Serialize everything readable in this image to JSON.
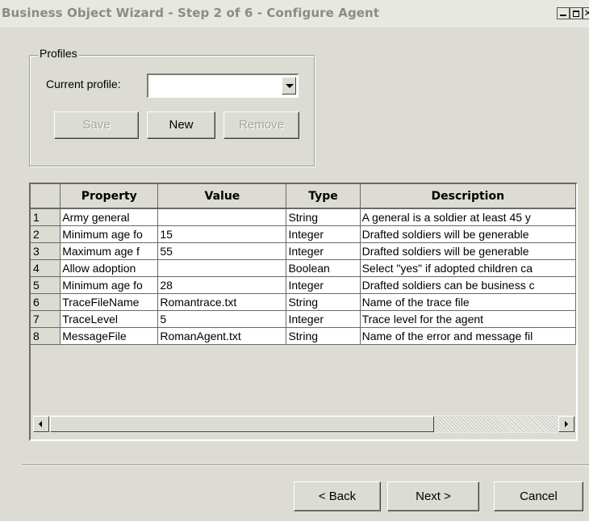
{
  "window": {
    "title": "Business Object Wizard - Step 2 of 6 - Configure Agent",
    "controls": [
      "minimize",
      "maximize",
      "close"
    ]
  },
  "profiles": {
    "legend": "Profiles",
    "current_profile_label": "Current profile:",
    "current_profile_value": "",
    "buttons": {
      "save": "Save",
      "new": "New",
      "remove": "Remove"
    }
  },
  "grid": {
    "columns": [
      "",
      "Property",
      "Value",
      "Type",
      "Description"
    ],
    "rows": [
      {
        "num": "1",
        "property": "Army general",
        "value": "",
        "type": "String",
        "description": "A general is a soldier at least 45 y"
      },
      {
        "num": "2",
        "property": "Minimum age fo",
        "value": "15",
        "type": "Integer",
        "description": "Drafted soldiers will be generable"
      },
      {
        "num": "3",
        "property": "Maximum age f",
        "value": "55",
        "type": "Integer",
        "description": "Drafted soldiers will be generable"
      },
      {
        "num": "4",
        "property": "Allow adoption",
        "value": "",
        "type": "Boolean",
        "description": "Select \"yes\" if adopted children ca"
      },
      {
        "num": "5",
        "property": "Minimum age fo",
        "value": "28",
        "type": "Integer",
        "description": "Drafted soldiers can be business c"
      },
      {
        "num": "6",
        "property": "TraceFileName",
        "value": "Romantrace.txt",
        "type": "String",
        "description": "Name of the trace file"
      },
      {
        "num": "7",
        "property": "TraceLevel",
        "value": "5",
        "type": "Integer",
        "description": "Trace level for the agent"
      },
      {
        "num": "8",
        "property": "MessageFile",
        "value": "RomanAgent.txt",
        "type": "String",
        "description": "Name of the error and message fil"
      }
    ]
  },
  "nav": {
    "back": "< Back",
    "next": "Next >",
    "cancel": "Cancel"
  },
  "colors": {
    "dialog_bg": "#dcdcd4",
    "title_text": "#8a8c86",
    "disabled_text": "#a4a49e"
  }
}
